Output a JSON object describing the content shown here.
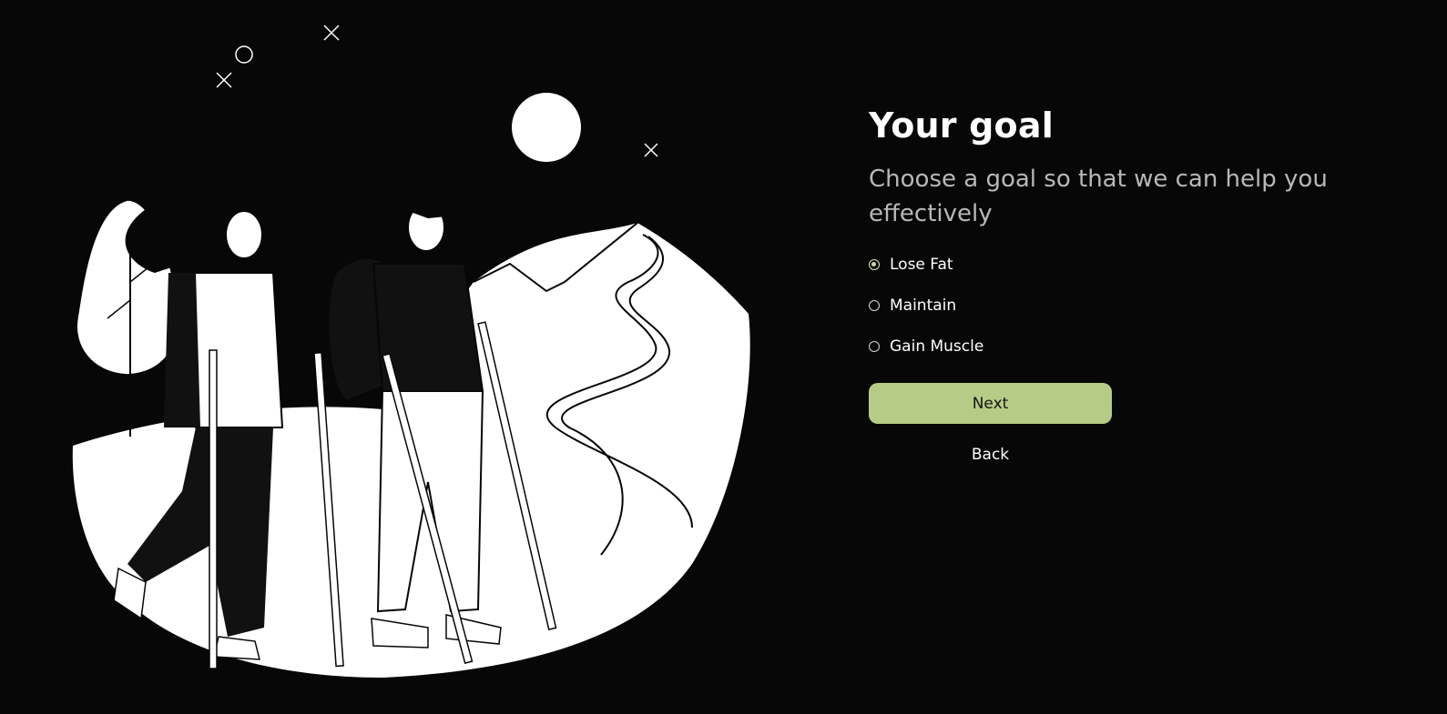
{
  "form": {
    "title": "Your goal",
    "subtitle": "Choose a goal so that we can help you effectively",
    "options": [
      {
        "label": "Lose Fat",
        "selected": true
      },
      {
        "label": "Maintain",
        "selected": false
      },
      {
        "label": "Gain Muscle",
        "selected": false
      }
    ],
    "next_label": "Next",
    "back_label": "Back"
  },
  "colors": {
    "background": "#070707",
    "accent": "#b6cc86",
    "subtitle": "#b8b8b8"
  },
  "illustration": {
    "subject": "hikers-illustration"
  }
}
